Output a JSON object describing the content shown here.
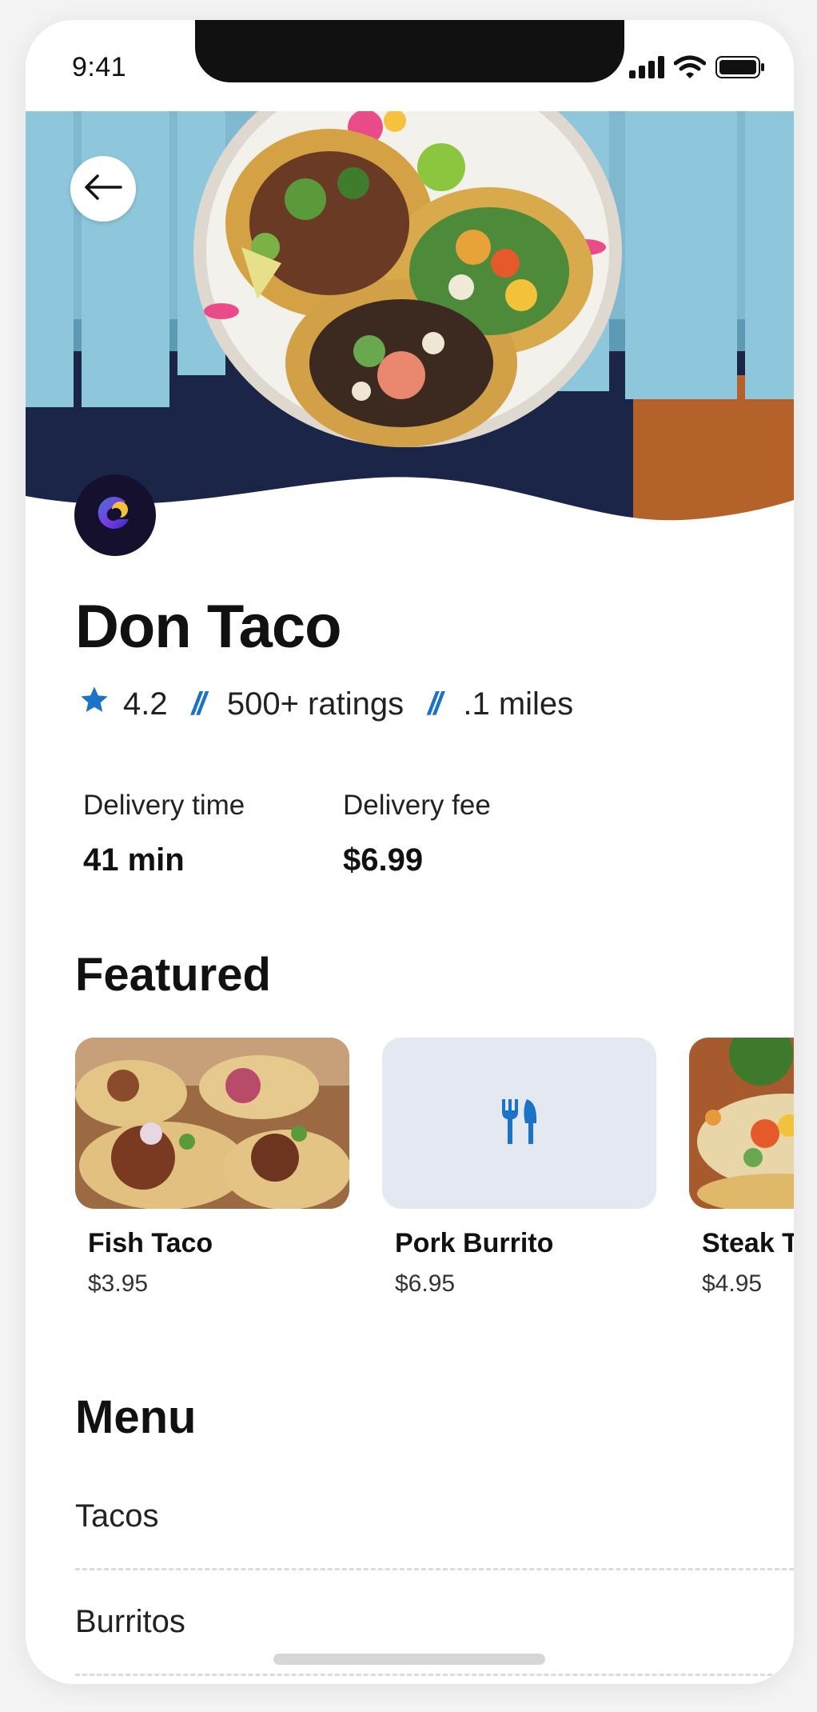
{
  "status_bar": {
    "time": "9:41"
  },
  "restaurant": {
    "name": "Don Taco",
    "rating": "4.2",
    "ratings_count": "500+ ratings",
    "distance": ".1 miles",
    "separator": "//"
  },
  "delivery": {
    "time_label": "Delivery time",
    "time_value": "41 min",
    "fee_label": "Delivery fee",
    "fee_value": "$6.99"
  },
  "featured": {
    "title": "Featured",
    "items": [
      {
        "name": "Fish Taco",
        "price": "$3.95"
      },
      {
        "name": "Pork Burrito",
        "price": "$6.95"
      },
      {
        "name": "Steak Taco",
        "price": "$4.95"
      }
    ]
  },
  "menu": {
    "title": "Menu",
    "items": [
      {
        "label": "Tacos"
      },
      {
        "label": "Burritos"
      }
    ]
  },
  "colors": {
    "accent": "#1a73c7",
    "hero_table": "#7fb8cf",
    "placeholder_bg": "#e4e8f0"
  },
  "icons": [
    "signal-icon",
    "wifi-icon",
    "battery-icon",
    "back-arrow-icon",
    "restaurant-logo-icon",
    "star-icon",
    "fork-knife-icon"
  ]
}
